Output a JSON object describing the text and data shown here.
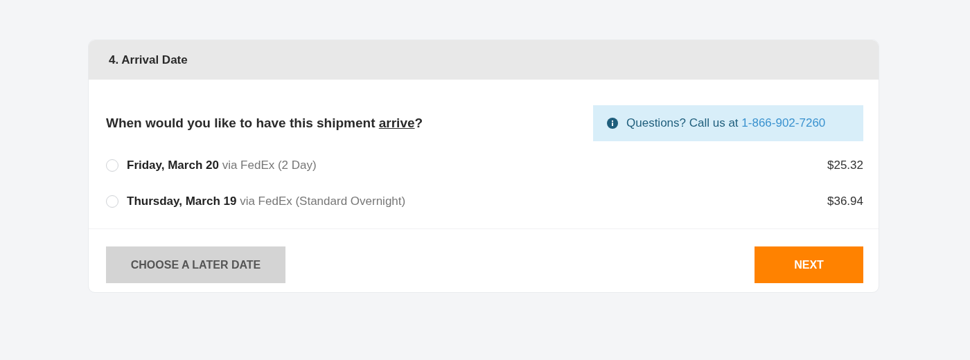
{
  "section": {
    "title": "4. Arrival Date"
  },
  "question": {
    "text_before": "When would you like to have this shipment ",
    "link": "arrive",
    "text_after": "?"
  },
  "info": {
    "text": "Questions? Call us at ",
    "phone": "1-866-902-7260"
  },
  "options": [
    {
      "date": "Friday, March 20",
      "carrier": "via FedEx (2 Day)",
      "price": "$25.32",
      "selected": false
    },
    {
      "date": "Thursday, March 19",
      "carrier": "via FedEx (Standard Overnight)",
      "price": "$36.94",
      "selected": false
    }
  ],
  "buttons": [
    {
      "label": "CHOOSE A LATER DATE",
      "kind": "secondary"
    },
    {
      "label": "NEXT",
      "kind": "primary"
    }
  ]
}
